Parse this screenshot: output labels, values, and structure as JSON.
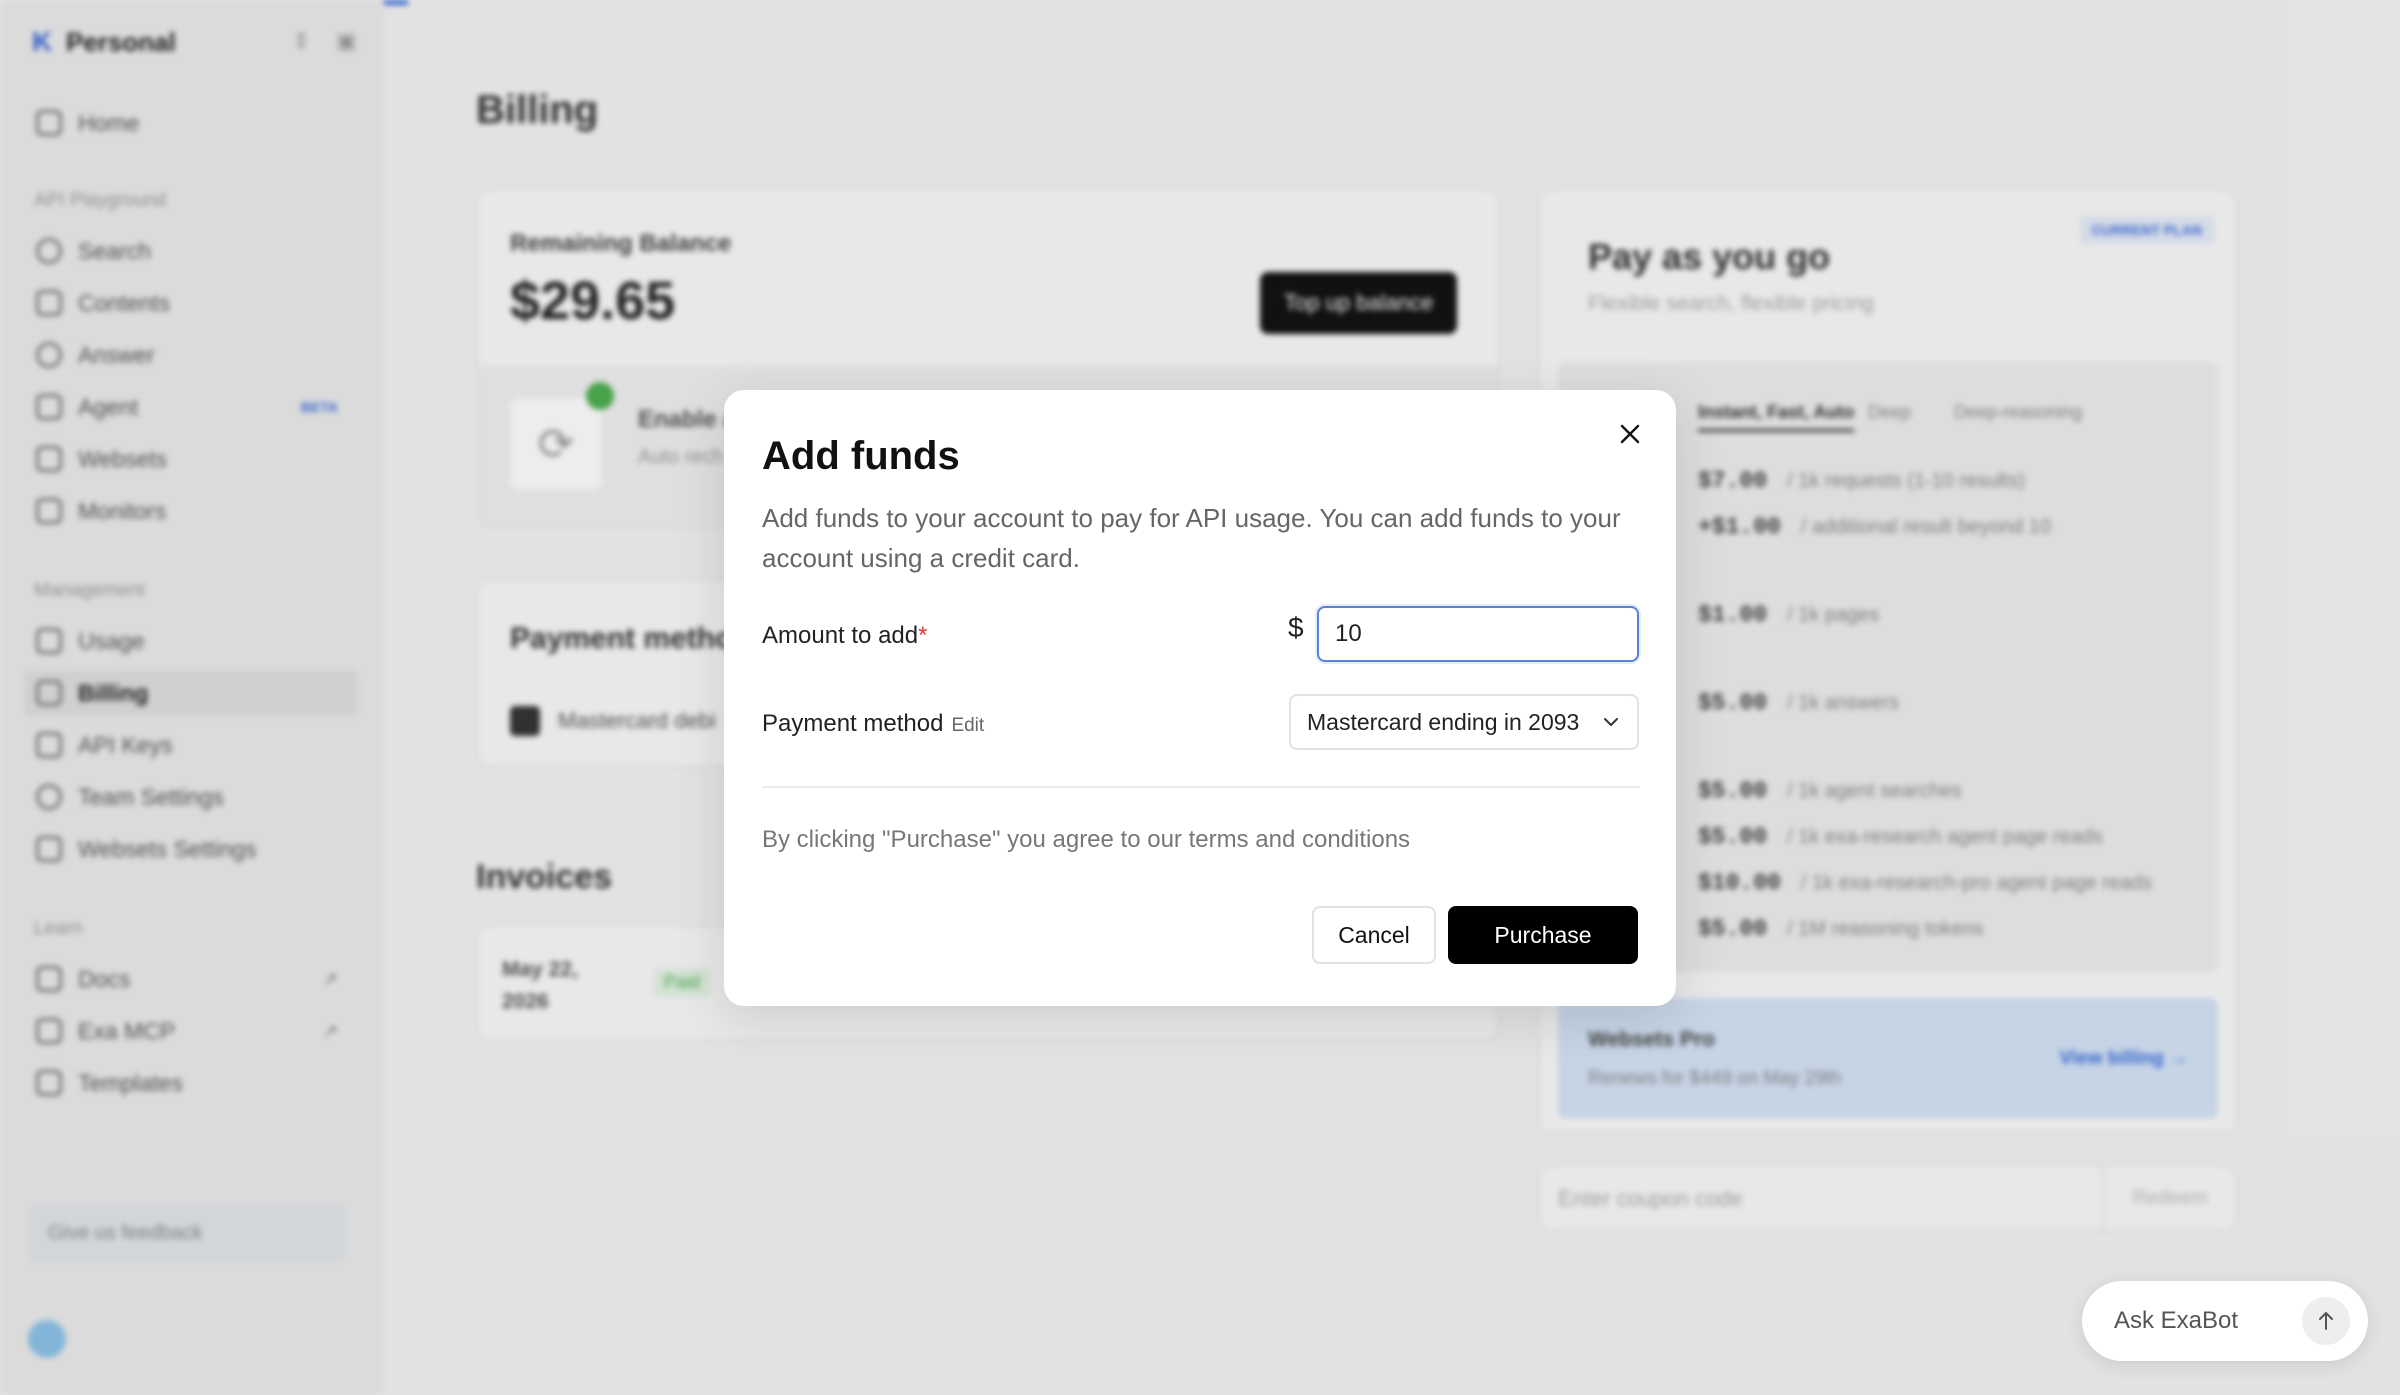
{
  "sidebar": {
    "workspace": "Personal",
    "home": "Home",
    "section_playground": "API Playground",
    "search": "Search",
    "contents": "Contents",
    "answer": "Answer",
    "agent": "Agent",
    "agent_badge": "BETA",
    "websets": "Websets",
    "monitors": "Monitors",
    "section_management": "Management",
    "usage": "Usage",
    "billing": "Billing",
    "api_keys": "API Keys",
    "team_settings": "Team Settings",
    "websets_settings": "Websets Settings",
    "section_learn": "Learn",
    "docs": "Docs",
    "exa_mcp": "Exa MCP",
    "templates": "Templates",
    "feedback": "Give us feedback"
  },
  "main": {
    "title": "Billing",
    "balance_label": "Remaining Balance",
    "balance_value": "$29.65",
    "topup_label": "Top up balance",
    "autorecharge_title": "Enable a",
    "autorecharge_sub": "Auto rech",
    "payment_heading": "Payment method",
    "payment_card": "Mastercard debi",
    "invoices_heading": "Invoices",
    "invoice_date": "May 22, 2026",
    "invoice_status": "Paid",
    "plan": {
      "name": "Pay as you go",
      "subtitle": "Flexible search, flexible pricing",
      "tag": "CURRENT PLAN",
      "tabs": [
        "Instant, Fast, Auto",
        "Deep",
        "Deep-reasoning"
      ],
      "prices": [
        {
          "price": "$7.00",
          "desc": "/ 1k requests (1-10 results)"
        },
        {
          "price": "+$1.00",
          "desc": "/ additional result beyond 10"
        },
        {
          "price": "$1.00",
          "desc": "/ 1k pages"
        },
        {
          "price": "$5.00",
          "desc": "/ 1k answers"
        },
        {
          "price": "$5.00",
          "desc": "/ 1k agent searches"
        },
        {
          "price": "$5.00",
          "desc": "/ 1k exa-research agent page reads"
        },
        {
          "price": "$10.00",
          "desc": "/ 1k exa-research-pro agent page reads"
        },
        {
          "price": "$5.00",
          "desc": "/ 1M reasoning tokens"
        }
      ]
    },
    "websets_pro": {
      "title": "Websets Pro",
      "renews": "Renews for $449 on May 29th",
      "link": "View billing →"
    },
    "coupon_placeholder": "Enter coupon code",
    "redeem": "Redeem"
  },
  "modal": {
    "title": "Add funds",
    "description": "Add funds to your account to pay for API usage. You can add funds to your account using a credit card.",
    "amount_label": "Amount to add",
    "required_mark": "*",
    "currency": "$",
    "amount_value": "10",
    "payment_label": "Payment method",
    "edit_label": "Edit",
    "payment_selected": "Mastercard ending in 2093",
    "terms": "By clicking \"Purchase\" you agree to our terms and conditions",
    "cancel_label": "Cancel",
    "purchase_label": "Purchase"
  },
  "exabot": {
    "label": "Ask ExaBot"
  },
  "colors": {
    "accent": "#3b6ee0",
    "focus_border": "#5b82d4",
    "primary_button": "#000000",
    "required": "#e53935"
  }
}
